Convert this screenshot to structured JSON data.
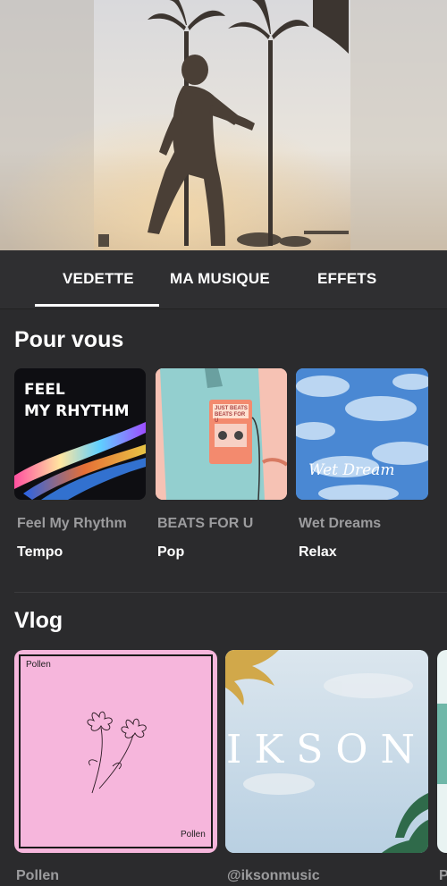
{
  "tabs": [
    {
      "label": "VEDETTE",
      "active": true
    },
    {
      "label": "MA MUSIQUE",
      "active": false
    },
    {
      "label": "EFFETS",
      "active": false
    }
  ],
  "sections": {
    "for_you": {
      "title": "Pour vous",
      "items": [
        {
          "title": "Feel My Rhythm",
          "genre": "Tempo",
          "cover_text": "FEEL\nMY RHYTHM"
        },
        {
          "title": "BEATS FOR U",
          "genre": "Pop",
          "cover_text": "JUST BEATS  BEATS FOR U"
        },
        {
          "title": "Wet Dreams",
          "genre": "Relax",
          "cover_text": "Wet Dream"
        }
      ]
    },
    "vlog": {
      "title": "Vlog",
      "items": [
        {
          "title": "Pollen",
          "cover_text_top": "Pollen",
          "cover_text_bottom": "Pollen"
        },
        {
          "title": "@iksonmusic",
          "cover_text": "IKSON"
        },
        {
          "title": "P"
        }
      ]
    }
  },
  "colors": {
    "background": "#2b2b2d",
    "tab_bar": "#2f2f31",
    "secondary_text": "#9c9c9e",
    "pollen_pink": "#f6b6dc"
  }
}
